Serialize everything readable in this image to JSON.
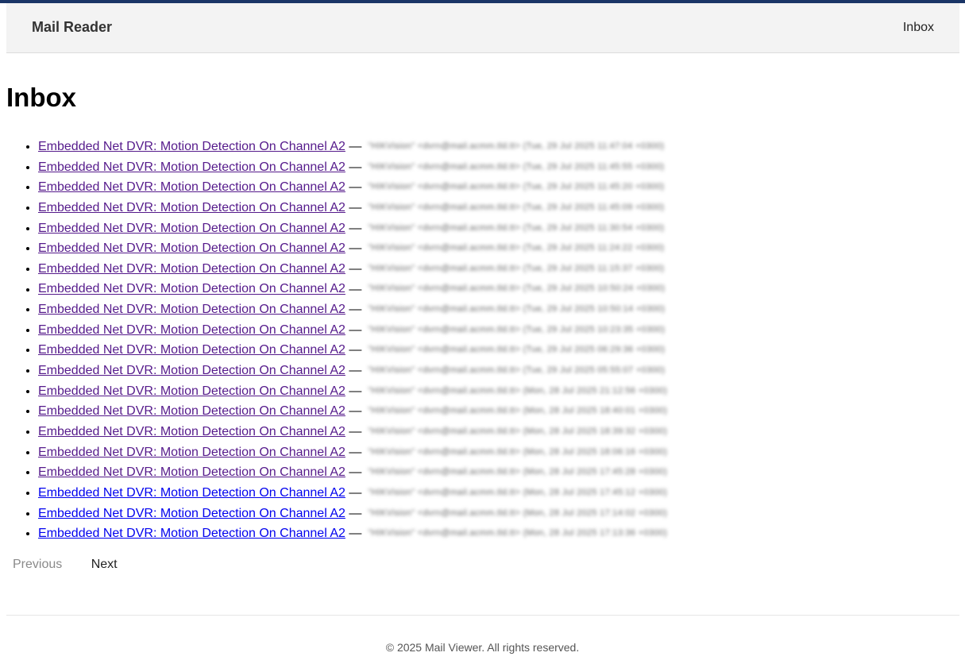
{
  "navbar": {
    "brand": "Mail Reader",
    "inbox_link": "Inbox"
  },
  "page": {
    "title": "Inbox"
  },
  "mails": [
    {
      "subject": "Embedded Net DVR: Motion Detection On Channel A2",
      "sender": "\"HIKVision\" <dvrn@mail.acmm.tld.tt> (Tue, 29 Jul 2025 11:47:04 +0300)",
      "visited": true
    },
    {
      "subject": "Embedded Net DVR: Motion Detection On Channel A2",
      "sender": "\"HIKVision\" <dvrn@mail.acmm.tld.tt> (Tue, 29 Jul 2025 11:45:55 +0300)",
      "visited": true
    },
    {
      "subject": "Embedded Net DVR: Motion Detection On Channel A2",
      "sender": "\"HIKVision\" <dvrn@mail.acmm.tld.tt> (Tue, 29 Jul 2025 11:45:20 +0300)",
      "visited": true
    },
    {
      "subject": "Embedded Net DVR: Motion Detection On Channel A2",
      "sender": "\"HIKVision\" <dvrn@mail.acmm.tld.tt> (Tue, 29 Jul 2025 11:45:09 +0300)",
      "visited": true
    },
    {
      "subject": "Embedded Net DVR: Motion Detection On Channel A2",
      "sender": "\"HIKVision\" <dvrn@mail.acmm.tld.tt> (Tue, 29 Jul 2025 11:30:54 +0300)",
      "visited": true
    },
    {
      "subject": "Embedded Net DVR: Motion Detection On Channel A2",
      "sender": "\"HIKVision\" <dvrn@mail.acmm.tld.tt> (Tue, 29 Jul 2025 11:24:22 +0300)",
      "visited": true
    },
    {
      "subject": "Embedded Net DVR: Motion Detection On Channel A2",
      "sender": "\"HIKVision\" <dvrn@mail.acmm.tld.tt> (Tue, 29 Jul 2025 11:15:37 +0300)",
      "visited": true
    },
    {
      "subject": "Embedded Net DVR: Motion Detection On Channel A2",
      "sender": "\"HIKVision\" <dvrn@mail.acmm.tld.tt> (Tue, 29 Jul 2025 10:50:24 +0300)",
      "visited": true
    },
    {
      "subject": "Embedded Net DVR: Motion Detection On Channel A2",
      "sender": "\"HIKVision\" <dvrn@mail.acmm.tld.tt> (Tue, 29 Jul 2025 10:50:14 +0300)",
      "visited": true
    },
    {
      "subject": "Embedded Net DVR: Motion Detection On Channel A2",
      "sender": "\"HIKVision\" <dvrn@mail.acmm.tld.tt> (Tue, 29 Jul 2025 10:23:35 +0300)",
      "visited": true
    },
    {
      "subject": "Embedded Net DVR: Motion Detection On Channel A2",
      "sender": "\"HIKVision\" <dvrn@mail.acmm.tld.tt> (Tue, 29 Jul 2025 06:29:36 +0300)",
      "visited": true
    },
    {
      "subject": "Embedded Net DVR: Motion Detection On Channel A2",
      "sender": "\"HIKVision\" <dvrn@mail.acmm.tld.tt> (Tue, 29 Jul 2025 05:55:07 +0300)",
      "visited": true
    },
    {
      "subject": "Embedded Net DVR: Motion Detection On Channel A2",
      "sender": "\"HIKVision\" <dvrn@mail.acmm.tld.tt> (Mon, 28 Jul 2025 21:12:56 +0300)",
      "visited": true
    },
    {
      "subject": "Embedded Net DVR: Motion Detection On Channel A2",
      "sender": "\"HIKVision\" <dvrn@mail.acmm.tld.tt> (Mon, 28 Jul 2025 18:40:01 +0300)",
      "visited": true
    },
    {
      "subject": "Embedded Net DVR: Motion Detection On Channel A2",
      "sender": "\"HIKVision\" <dvrn@mail.acmm.tld.tt> (Mon, 28 Jul 2025 18:39:32 +0300)",
      "visited": true
    },
    {
      "subject": "Embedded Net DVR: Motion Detection On Channel A2",
      "sender": "\"HIKVision\" <dvrn@mail.acmm.tld.tt> (Mon, 28 Jul 2025 18:06:16 +0300)",
      "visited": true
    },
    {
      "subject": "Embedded Net DVR: Motion Detection On Channel A2",
      "sender": "\"HIKVision\" <dvrn@mail.acmm.tld.tt> (Mon, 28 Jul 2025 17:45:28 +0300)",
      "visited": true
    },
    {
      "subject": "Embedded Net DVR: Motion Detection On Channel A2",
      "sender": "\"HIKVision\" <dvrn@mail.acmm.tld.tt> (Mon, 28 Jul 2025 17:45:12 +0300)",
      "visited": false
    },
    {
      "subject": "Embedded Net DVR: Motion Detection On Channel A2",
      "sender": "\"HIKVision\" <dvrn@mail.acmm.tld.tt> (Mon, 28 Jul 2025 17:14:02 +0300)",
      "visited": false
    },
    {
      "subject": "Embedded Net DVR: Motion Detection On Channel A2",
      "sender": "\"HIKVision\" <dvrn@mail.acmm.tld.tt> (Mon, 28 Jul 2025 17:13:36 +0300)",
      "visited": false
    }
  ],
  "separator": "—",
  "pager": {
    "previous_label": "Previous",
    "next_label": "Next"
  },
  "footer": {
    "text": "© 2025 Mail Viewer. All rights reserved."
  },
  "colors": {
    "accent_bar": "#1a3566",
    "visited_link": "#551a8b",
    "unvisited_link": "#0000ee"
  }
}
